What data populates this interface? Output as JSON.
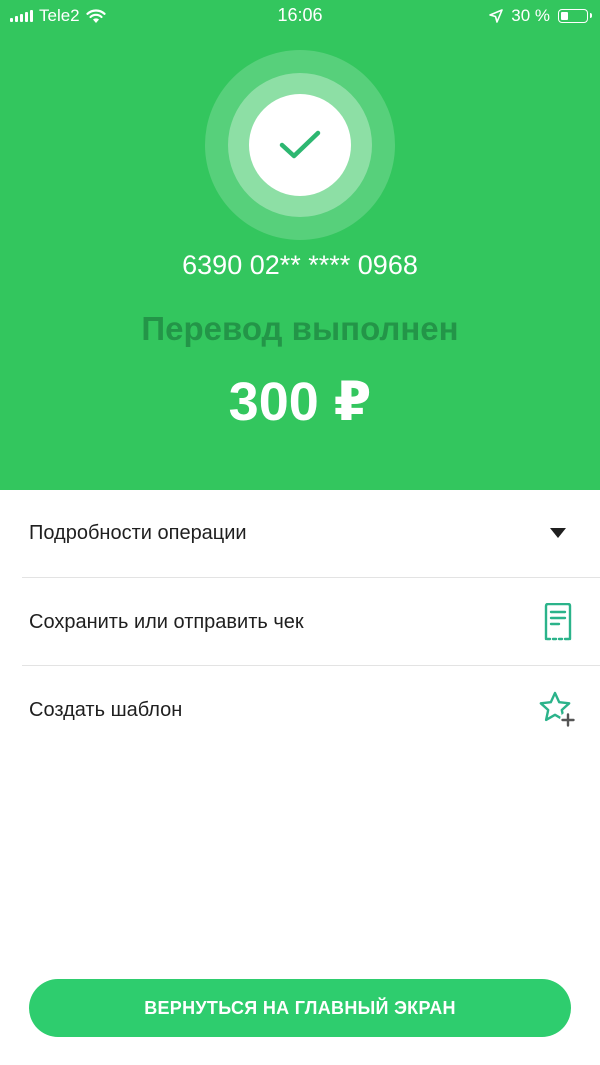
{
  "status_bar": {
    "carrier": "Tele2",
    "time": "16:06",
    "battery": "30 %",
    "battery_level": 0.3
  },
  "result": {
    "card_number": "6390 02** **** 0968",
    "title": "Перевод выполнен",
    "amount": "300 ₽"
  },
  "actions": [
    {
      "label": "Подробности операции",
      "icon": "triangle-down-icon"
    },
    {
      "label": "Сохранить или отправить чек",
      "icon": "receipt-icon"
    },
    {
      "label": "Создать шаблон",
      "icon": "star-plus-icon"
    }
  ],
  "home_button": {
    "label": "ВЕРНУТЬСЯ НА ГЛАВНЫЙ ЭКРАН"
  },
  "colors": {
    "hero_background": "#33c65e",
    "title_dark_green": "#239548",
    "button_green": "#2ecd6e",
    "icon_teal": "#2bb38a",
    "checkmark": "#2db771"
  }
}
